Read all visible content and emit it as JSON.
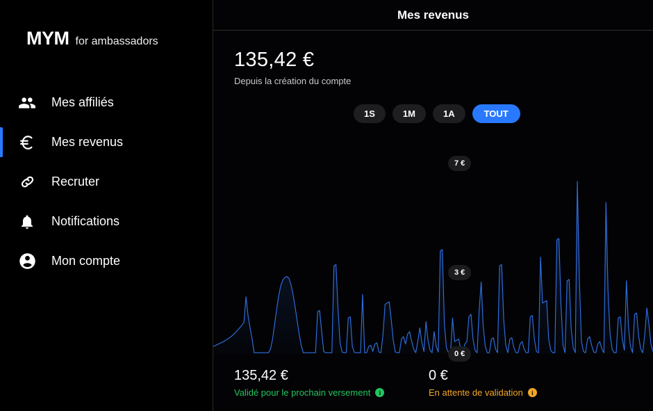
{
  "sidebar": {
    "brand": {
      "mark": "MYM",
      "sub": "for ambassadors"
    },
    "items": [
      {
        "label": "Mes affiliés",
        "icon": "people-icon",
        "active": false
      },
      {
        "label": "Mes revenus",
        "icon": "euro-icon",
        "active": true
      },
      {
        "label": "Recruter",
        "icon": "link-icon",
        "active": false
      },
      {
        "label": "Notifications",
        "icon": "bell-icon",
        "active": false
      },
      {
        "label": "Mon compte",
        "icon": "account-circle-icon",
        "active": false
      }
    ]
  },
  "header": {
    "title": "Mes revenus"
  },
  "summary": {
    "amount": "135,42 €",
    "caption": "Depuis la création du compte"
  },
  "range_filter": {
    "options": [
      "1S",
      "1M",
      "1A",
      "TOUT"
    ],
    "selected": "TOUT",
    "active_color": "#2979ff"
  },
  "footer_stats": [
    {
      "amount": "135,42 €",
      "label": "Validé pour le prochain versement",
      "color": "#22c55e",
      "icon": "info-icon"
    },
    {
      "amount": "0 €",
      "label": "En attente de validation",
      "color": "#f5a623",
      "icon": "info-icon"
    }
  ],
  "chart_data": {
    "type": "area",
    "title": "Mes revenus",
    "xlabel": "",
    "ylabel": "€",
    "ylim": [
      0,
      7
    ],
    "grid": false,
    "legend": false,
    "line_color": "#2f6fe0",
    "fill_color": "#16335e",
    "y_ticks": [
      "0 €",
      "3 €",
      "7 €"
    ],
    "y_tick_values": [
      0,
      3,
      7
    ],
    "series": [
      {
        "name": "Revenus",
        "values": [
          0.3,
          0.34,
          0.38,
          0.42,
          0.46,
          0.5,
          0.55,
          0.6,
          0.66,
          0.72,
          0.8,
          0.88,
          0.97,
          1.06,
          1.16,
          1.28,
          2.3,
          1.55,
          1.05,
          0.6,
          0.05,
          0.05,
          0.05,
          0.05,
          0.05,
          0.05,
          0.05,
          0.05,
          0.2,
          0.6,
          1.2,
          1.8,
          2.35,
          2.75,
          2.98,
          3.08,
          3.12,
          3.05,
          2.8,
          2.4,
          1.9,
          1.35,
          0.8,
          0.35,
          0.05,
          0.05,
          0.05,
          0.05,
          0.05,
          0.05,
          0.05,
          1.7,
          1.75,
          0.9,
          0.1,
          0.05,
          0.05,
          0.05,
          0.05,
          3.55,
          3.6,
          1.8,
          0.45,
          0.08,
          0.05,
          0.05,
          1.45,
          1.5,
          0.3,
          0.06,
          0.05,
          0.05,
          0.05,
          2.4,
          0.05,
          0.05,
          0.3,
          0.35,
          0.1,
          0.4,
          0.45,
          0.08,
          0.05,
          0.8,
          2.0,
          2.05,
          2.1,
          1.4,
          0.55,
          0.08,
          0.05,
          0.05,
          0.6,
          0.7,
          0.4,
          0.8,
          0.9,
          0.5,
          0.2,
          0.05,
          0.5,
          1.05,
          0.45,
          0.1,
          1.3,
          0.55,
          0.15,
          0.05,
          0.9,
          0.3,
          0.08,
          4.15,
          4.2,
          1.2,
          0.25,
          0.05,
          0.05,
          1.45,
          0.5,
          0.55,
          0.6,
          0.2,
          0.05,
          0.4,
          0.5,
          1.5,
          1.6,
          0.6,
          0.15,
          0.05,
          1.75,
          2.9,
          1.1,
          0.3,
          0.05,
          0.05,
          0.6,
          0.65,
          0.2,
          0.05,
          3.55,
          3.6,
          1.4,
          0.35,
          0.05,
          0.6,
          0.65,
          0.25,
          0.05,
          0.05,
          0.4,
          0.5,
          0.2,
          0.05,
          0.05,
          1.5,
          1.55,
          0.6,
          0.1,
          0.05,
          3.9,
          2.05,
          2.1,
          2.15,
          0.6,
          0.15,
          0.05,
          0.05,
          4.6,
          4.65,
          2.0,
          0.35,
          0.05,
          2.95,
          3.0,
          1.0,
          0.25,
          0.05,
          6.95,
          3.0,
          0.5,
          0.1,
          0.05,
          0.6,
          0.7,
          0.35,
          0.08,
          0.05,
          0.4,
          0.5,
          0.2,
          0.05,
          6.1,
          2.55,
          0.8,
          0.2,
          0.05,
          0.05,
          1.45,
          1.5,
          0.6,
          0.15,
          2.95,
          1.1,
          0.3,
          0.05,
          1.6,
          1.65,
          0.7,
          0.2,
          0.05,
          0.8,
          1.85,
          1.2,
          0.4,
          0.1
        ]
      }
    ]
  }
}
